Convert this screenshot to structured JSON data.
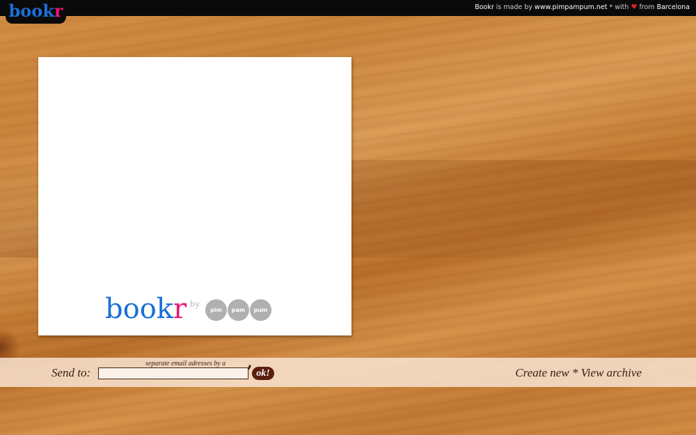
{
  "header": {
    "logo": {
      "part1": "book",
      "part2": "r"
    },
    "credits": {
      "app": "Bookr",
      "made_by": "is made by",
      "site": "www.pimpampum.net",
      "separator": "*",
      "with": "with",
      "heart": "♥",
      "from": "from",
      "city": "Barcelona"
    }
  },
  "card": {
    "logo": {
      "part1": "book",
      "part2": "r"
    },
    "by": "by",
    "circles": [
      "pim",
      "pam",
      "pum"
    ]
  },
  "send_bar": {
    "label": "Send to:",
    "hint": "separate email adresses by a",
    "comma": ",",
    "email_value": "",
    "ok_label": "ok!",
    "create_new": "Create new",
    "link_separator": "*",
    "view_archive": "View archive"
  },
  "colors": {
    "logo_blue": "#1a6fd6",
    "logo_pink": "#e6197a",
    "topbar": "#0a0a0a",
    "button": "#5a1e0f",
    "heart": "#e0202a"
  },
  "icons": {
    "heart": "heart-icon",
    "circles": [
      "pim-badge-icon",
      "pam-badge-icon",
      "pum-badge-icon"
    ]
  }
}
